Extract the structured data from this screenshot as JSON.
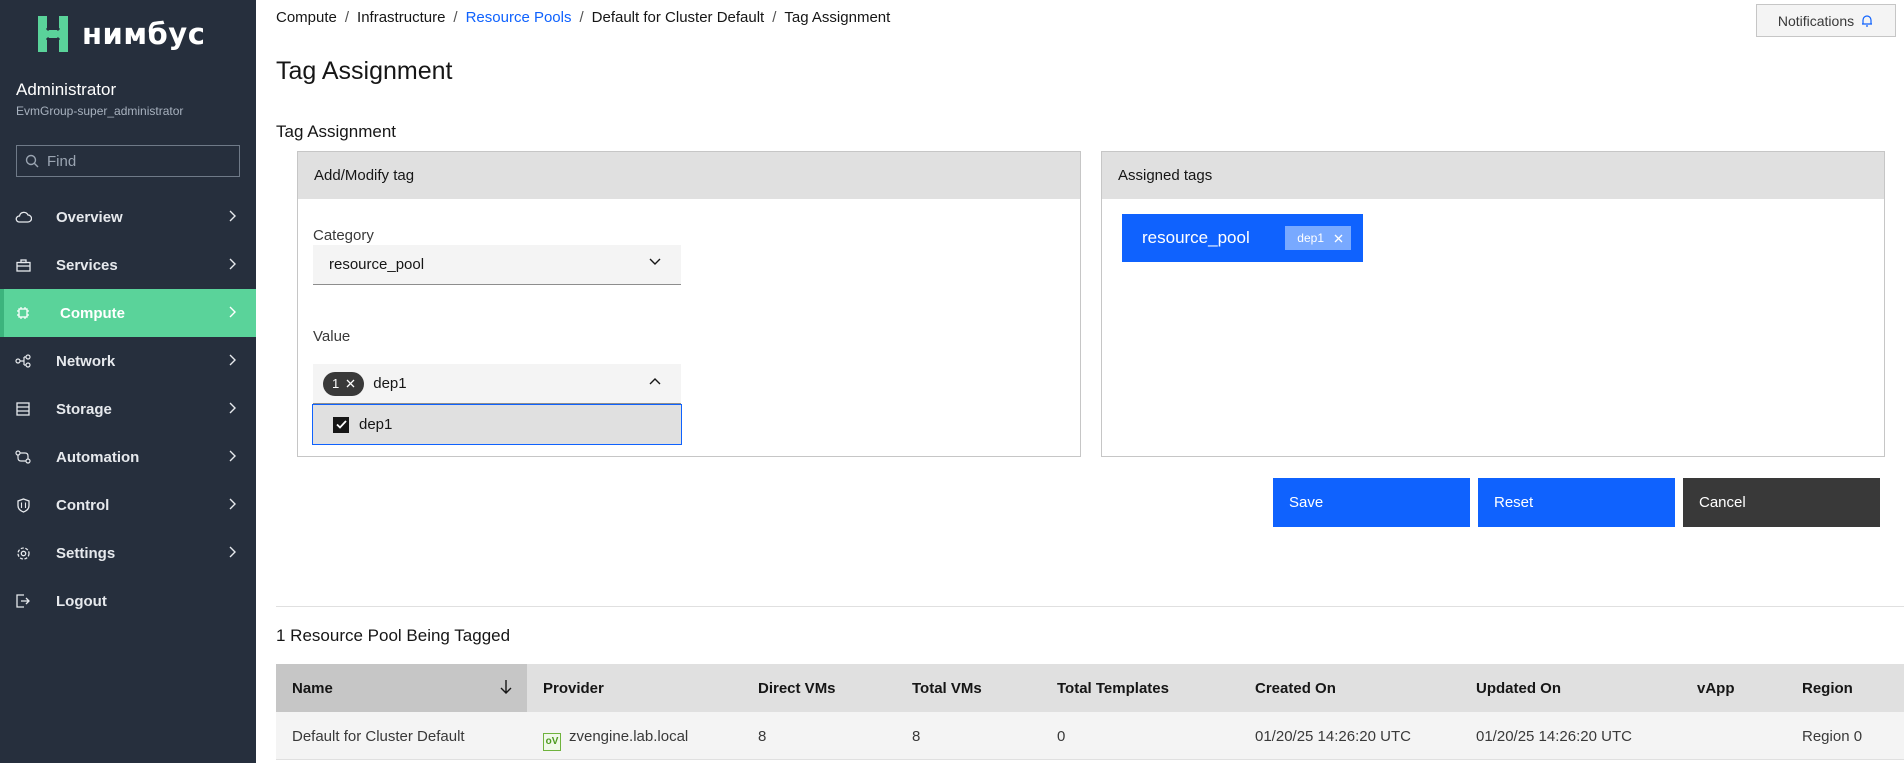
{
  "sidebar": {
    "brand": "нимбус",
    "user_name": "Administrator",
    "user_group": "EvmGroup-super_administrator",
    "search_placeholder": "Find",
    "items": [
      {
        "label": "Overview",
        "icon": "cloud-icon"
      },
      {
        "label": "Services",
        "icon": "briefcase-icon"
      },
      {
        "label": "Compute",
        "icon": "chip-icon",
        "active": true
      },
      {
        "label": "Network",
        "icon": "network-icon"
      },
      {
        "label": "Storage",
        "icon": "storage-icon"
      },
      {
        "label": "Automation",
        "icon": "automation-icon"
      },
      {
        "label": "Control",
        "icon": "shield-icon"
      },
      {
        "label": "Settings",
        "icon": "gear-icon"
      },
      {
        "label": "Logout",
        "icon": "logout-icon"
      }
    ]
  },
  "breadcrumb": [
    "Compute",
    "Infrastructure",
    "Resource Pools",
    "Default for Cluster Default",
    "Tag Assignment"
  ],
  "notifications_label": "Notifications",
  "page_title": "Tag Assignment",
  "section_title": "Tag Assignment",
  "add_panel": {
    "header": "Add/Modify tag",
    "category_label": "Category",
    "category_value": "resource_pool",
    "value_label": "Value",
    "selected_count": "1",
    "value_input": "dep1",
    "options": [
      {
        "label": "dep1",
        "checked": true
      }
    ]
  },
  "assigned_panel": {
    "header": "Assigned tags",
    "category": "resource_pool",
    "tag": "dep1"
  },
  "buttons": {
    "save": "Save",
    "reset": "Reset",
    "cancel": "Cancel"
  },
  "tagged_title": "1 Resource Pool Being Tagged",
  "table": {
    "columns": [
      "Name",
      "Provider",
      "Direct VMs",
      "Total VMs",
      "Total Templates",
      "Created On",
      "Updated On",
      "vApp",
      "Region"
    ],
    "rows": [
      {
        "name": "Default for Cluster Default",
        "provider": "zvengine.lab.local",
        "direct_vms": "8",
        "total_vms": "8",
        "total_templates": "0",
        "created_on": "01/20/25 14:26:20 UTC",
        "updated_on": "01/20/25 14:26:20 UTC",
        "vapp": "",
        "region": "Region 0"
      }
    ]
  },
  "colors": {
    "sidebar_bg": "#262f3d",
    "active_nav": "#5ad39a",
    "primary": "#0f62fe",
    "secondary": "#393939"
  }
}
